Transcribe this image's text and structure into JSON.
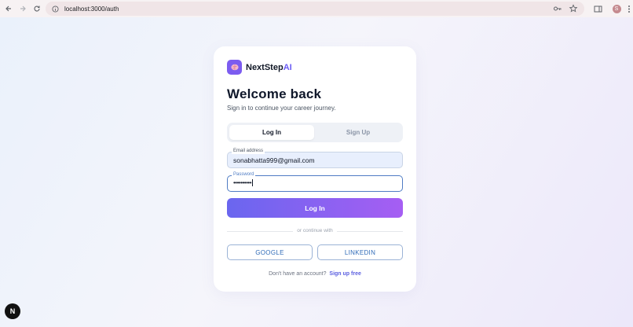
{
  "browser": {
    "url": "localhost:3000/auth",
    "profile_initial": "S",
    "icons": [
      "back-icon",
      "forward-icon",
      "reload-icon",
      "site-info-icon",
      "key-icon",
      "star-icon",
      "side-panel-icon",
      "kebab-menu-icon"
    ]
  },
  "brand": {
    "name_part1": "NextStep",
    "name_part2": "AI",
    "logo_icon": "brain-icon",
    "logo_color": "#7c5cf0",
    "accent_color": "#6a5cf4"
  },
  "auth": {
    "title": "Welcome back",
    "subtitle": "Sign in to continue your career journey.",
    "tabs": [
      {
        "label": "Log In",
        "active": true
      },
      {
        "label": "Sign Up",
        "active": false
      }
    ],
    "email": {
      "label": "Email address",
      "value": "sonabhatta999@gmail.com"
    },
    "password": {
      "label": "Password",
      "value": "••••••••••"
    },
    "submit_label": "Log In",
    "divider_text": "or continue with",
    "social": [
      {
        "label": "GOOGLE"
      },
      {
        "label": "LINKEDIN"
      }
    ],
    "footer_text": "Don't have an account?",
    "footer_link": "Sign up free",
    "button_gradient": [
      "#6a66ef",
      "#a65ef3"
    ]
  },
  "dev_badge": {
    "label": "N"
  }
}
